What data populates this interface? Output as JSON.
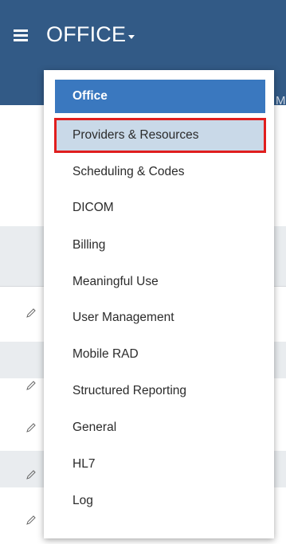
{
  "header": {
    "title": "OFFICE",
    "tail_letter": "M"
  },
  "menu": {
    "items": [
      {
        "label": "Office"
      },
      {
        "label": "Providers & Resources"
      },
      {
        "label": "Scheduling & Codes"
      },
      {
        "label": "DICOM"
      },
      {
        "label": "Billing"
      },
      {
        "label": "Meaningful Use"
      },
      {
        "label": "User Management"
      },
      {
        "label": "Mobile RAD"
      },
      {
        "label": "Structured Reporting"
      },
      {
        "label": "General"
      },
      {
        "label": "HL7"
      },
      {
        "label": "Log"
      }
    ],
    "active_item": "Office",
    "highlighted_item": "Providers & Resources"
  },
  "icons": {
    "menu": "hamburger-icon",
    "dropdown": "caret-down-icon",
    "edit": "pencil-icon"
  },
  "colors": {
    "header_bg": "#325a86",
    "active_item_bg": "#3a78bf",
    "highlight_bg": "#c9d9e8",
    "highlight_border": "#e01e1e"
  }
}
